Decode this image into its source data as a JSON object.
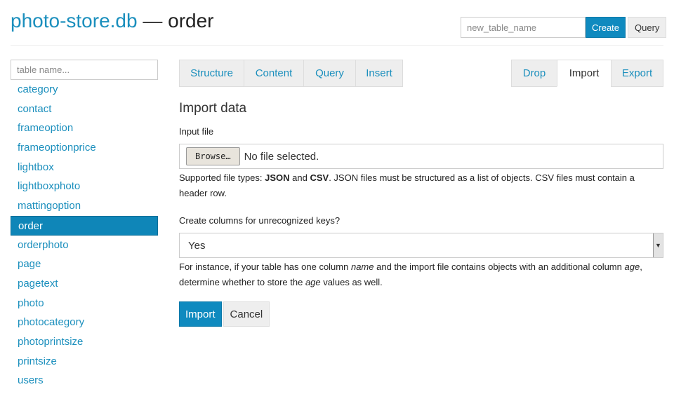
{
  "header": {
    "db_name": "photo-store.db",
    "separator": " — ",
    "table_name": "order",
    "new_table_placeholder": "new_table_name",
    "create_label": "Create",
    "query_label": "Query"
  },
  "sidebar": {
    "search_placeholder": "table name...",
    "items": [
      {
        "label": "category"
      },
      {
        "label": "contact"
      },
      {
        "label": "frameoption"
      },
      {
        "label": "frameoptionprice"
      },
      {
        "label": "lightbox"
      },
      {
        "label": "lightboxphoto"
      },
      {
        "label": "mattingoption"
      },
      {
        "label": "order",
        "active": true
      },
      {
        "label": "orderphoto"
      },
      {
        "label": "page"
      },
      {
        "label": "pagetext"
      },
      {
        "label": "photo"
      },
      {
        "label": "photocategory"
      },
      {
        "label": "photoprintsize"
      },
      {
        "label": "printsize"
      },
      {
        "label": "users"
      }
    ]
  },
  "tabs": {
    "structure": "Structure",
    "content": "Content",
    "query": "Query",
    "insert": "Insert",
    "drop": "Drop",
    "import": "Import",
    "export": "Export",
    "active": "import"
  },
  "import_form": {
    "heading": "Import data",
    "input_file_label": "Input file",
    "browse_label": "Browse…",
    "no_file_text": "No file selected.",
    "types_prefix": "Supported file types: ",
    "type_json": "JSON",
    "types_and": " and ",
    "type_csv": "CSV",
    "types_suffix": ". JSON files must be structured as a list of objects. CSV files must contain a header row.",
    "create_columns_label": "Create columns for unrecognized keys?",
    "create_columns_value": "Yes",
    "help_part1": "For instance, if your table has one column ",
    "help_name": "name",
    "help_part2": " and the import file contains objects with an additional column ",
    "help_age": "age",
    "help_part3": ", determine whether to store the ",
    "help_age2": "age",
    "help_part4": " values as well.",
    "import_button": "Import",
    "cancel_button": "Cancel"
  },
  "colors": {
    "accent": "#0f8abf",
    "link": "#1b8fbd"
  }
}
